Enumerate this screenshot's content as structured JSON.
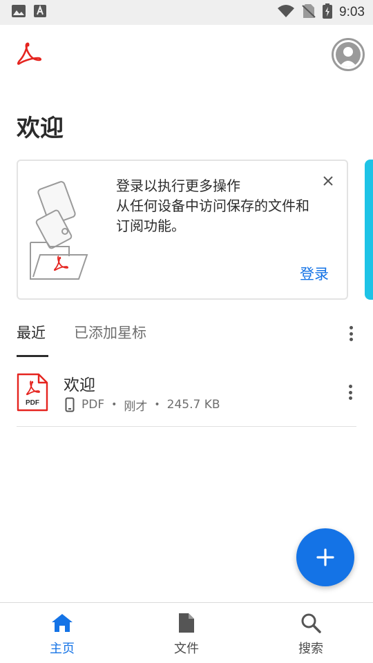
{
  "status_bar": {
    "time": "9:03",
    "icons": [
      "image-icon",
      "font-icon",
      "wifi-icon",
      "no-sim-icon",
      "battery-charging-icon"
    ]
  },
  "header": {
    "logo_icon": "acrobat-logo-icon",
    "avatar_icon": "user-avatar-icon",
    "title": "欢迎"
  },
  "signin_card": {
    "line1": "登录以执行更多操作",
    "line2": "从任何设备中访问保存的文件和",
    "line3": "订阅功能。",
    "signin_label": "登录",
    "close_icon": "close-icon"
  },
  "tabs": [
    {
      "label": "最近",
      "active": true
    },
    {
      "label": "已添加星标",
      "active": false
    }
  ],
  "files": [
    {
      "name": "欢迎",
      "type": "PDF",
      "icon_label": "PDF",
      "time": "刚才",
      "size": "245.7 KB",
      "location_icon": "phone-device-icon"
    }
  ],
  "bottom_nav": [
    {
      "label": "主页",
      "icon": "home-icon",
      "active": true
    },
    {
      "label": "文件",
      "icon": "file-icon",
      "active": false
    },
    {
      "label": "搜索",
      "icon": "search-icon",
      "active": false
    }
  ],
  "colors": {
    "accent": "#1473e6",
    "acrobat_red": "#e5241f",
    "edge_tab": "#1ec3e6"
  }
}
